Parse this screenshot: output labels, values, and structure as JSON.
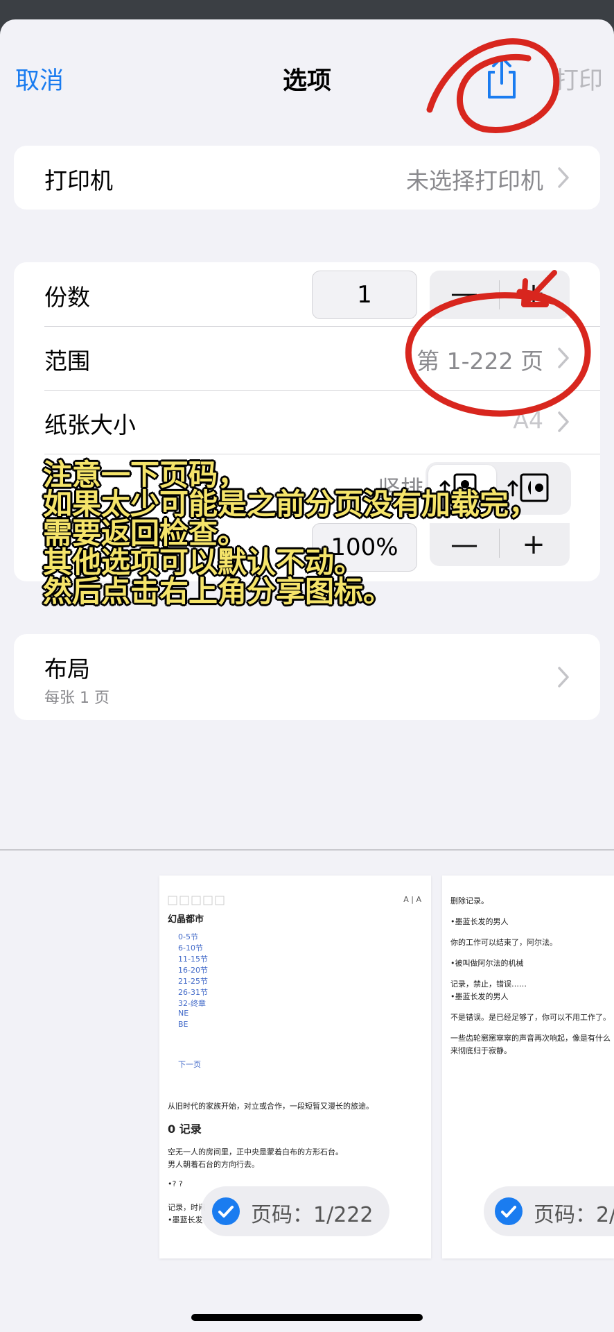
{
  "nav": {
    "cancel": "取消",
    "title": "选项",
    "print": "打印"
  },
  "printer": {
    "label": "打印机",
    "value": "未选择打印机"
  },
  "options": {
    "copies_label": "份数",
    "copies_value": "1",
    "copies_minus": "—",
    "copies_plus": "+",
    "range_label": "范围",
    "range_value": "第 1-222 页",
    "paper_label": "纸张大小",
    "paper_value": "A4",
    "orientation_value": "竖排",
    "scale_value": "100%",
    "scale_minus": "—",
    "scale_plus": "+"
  },
  "layout": {
    "label": "布局",
    "sub": "每张 1 页"
  },
  "overlay_lines": [
    "注意一下页码，",
    "如果太少可能是之前分页没有加载完，",
    "需要返回检查。",
    "其他选项可以默认不动。",
    "然后点击右上角分享图标。"
  ],
  "preview1": {
    "font_ctrl": "A | A",
    "title": "幻晶都市",
    "toc": [
      "0-5节",
      "6-10节",
      "11-15节",
      "16-20节",
      "21-25节",
      "26-31节",
      "32-终章",
      "NE",
      "BE"
    ],
    "next": "下一页",
    "intro": "从旧时代的家族开始，对立或合作，一段短暂又漫长的旅途。",
    "heading": "0 记录",
    "p1": "空无一人的房间里，正中央是蒙着白布的方形石台。",
    "p2": "男人朝着石台的方向行去。",
    "p3": "•? ?",
    "p4": "记录，时间",
    "p5": "•墨蓝长发",
    "page_label": "页码：1/222"
  },
  "preview2": {
    "lines": [
      "删除记录。",
      "•墨蓝长发的男人",
      "你的工作可以结束了，阿尔法。",
      "•被叫做阿尔法的机械",
      "记录，禁止，错误……",
      "•墨蓝长发的男人",
      "不是错误。是已经足够了，你可以不用工作了。",
      "一些齿轮窸窸窣窣的声音再次响起，像是有什么",
      "来彻底归于寂静。"
    ],
    "page_label": "页码：2/"
  },
  "colors": {
    "accent": "#1a7cf0",
    "annotation": "#d8261e",
    "overlay_text": "#f5e46a"
  }
}
